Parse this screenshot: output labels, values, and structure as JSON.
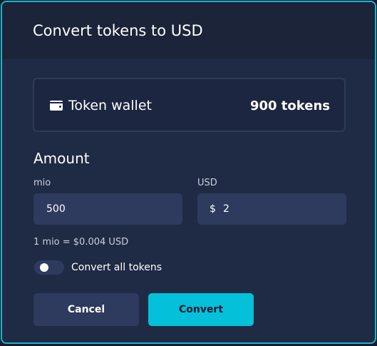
{
  "dialog": {
    "title": "Convert tokens to USD"
  },
  "wallet": {
    "label": "Token wallet",
    "icon": "wallet-icon",
    "balance": "900 tokens"
  },
  "amount": {
    "heading": "Amount",
    "token_field": {
      "label": "mio",
      "value": "500"
    },
    "usd_field": {
      "label": "USD",
      "prefix": "$",
      "value": "2"
    },
    "rate": "1 mio = $0.004 USD",
    "convert_all": {
      "label": "Convert all tokens",
      "enabled": false
    }
  },
  "actions": {
    "cancel_label": "Cancel",
    "convert_label": "Convert"
  },
  "colors": {
    "accent": "#04c0d9",
    "border": "#1bb3c9",
    "surface": "#1f2a44",
    "field": "#2e3a5e"
  }
}
